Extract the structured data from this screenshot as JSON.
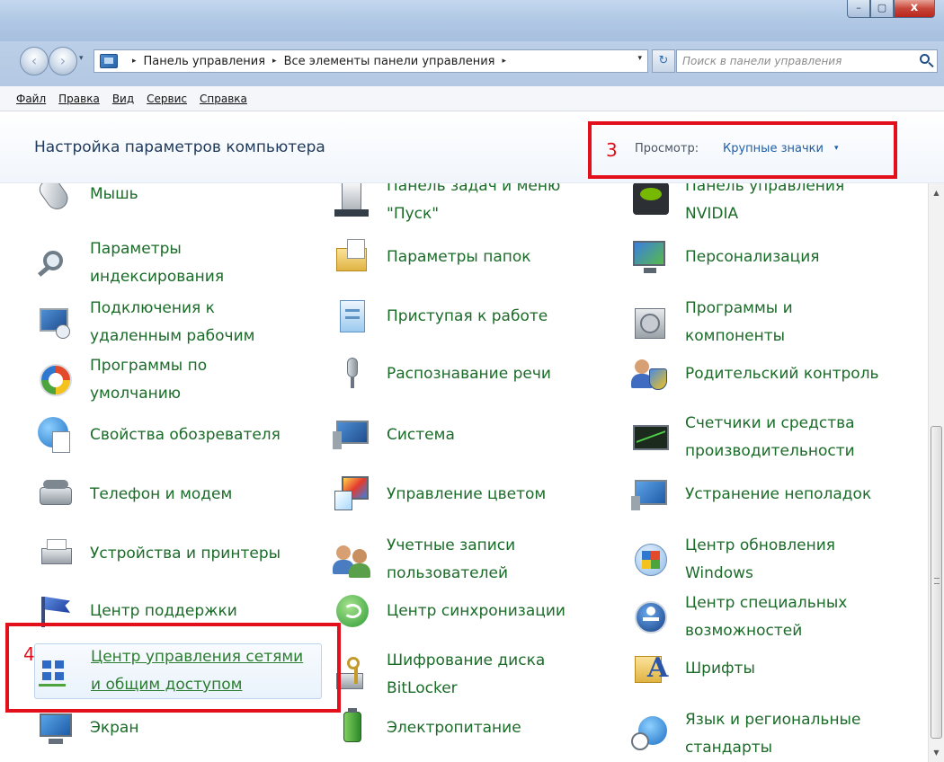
{
  "window": {
    "buttons": {
      "minimize": "–",
      "maximize": "▢",
      "close": "x"
    }
  },
  "nav": {
    "back": "‹",
    "forward": "›",
    "dropdown": "▾",
    "breadcrumb": [
      "Панель управления",
      "Все элементы панели управления"
    ],
    "separator": "▸",
    "address_dropdown": "▾",
    "refresh": "↻",
    "search_placeholder": "Поиск в панели управления"
  },
  "menu": [
    "Файл",
    "Правка",
    "Вид",
    "Сервис",
    "Справка"
  ],
  "header": {
    "title": "Настройка параметров компьютера",
    "view_label": "Просмотр:",
    "view_value": "Крупные значки",
    "view_caret": "▾"
  },
  "items": {
    "col1": [
      {
        "label": "Мышь",
        "icon": "mouse-icon"
      },
      {
        "label": "Параметры индексирования",
        "icon": "indexing-icon"
      },
      {
        "label": "Подключения к удаленным рабочим",
        "icon": "remote-desktop-icon"
      },
      {
        "label": "Программы по умолчанию",
        "icon": "default-programs-icon"
      },
      {
        "label": "Свойства обозревателя",
        "icon": "internet-options-icon"
      },
      {
        "label": "Телефон и модем",
        "icon": "phone-modem-icon"
      },
      {
        "label": "Устройства и принтеры",
        "icon": "printer-icon"
      },
      {
        "label": "Центр поддержки",
        "icon": "action-center-flag-icon"
      },
      {
        "label": "Центр управления сетями и общим доступом",
        "icon": "network-center-icon"
      },
      {
        "label": "Экран",
        "icon": "display-icon"
      }
    ],
    "col2": [
      {
        "label": "Панель задач и меню \"Пуск\"",
        "icon": "taskbar-icon"
      },
      {
        "label": "Параметры папок",
        "icon": "folder-options-icon"
      },
      {
        "label": "Приступая к работе",
        "icon": "getting-started-icon"
      },
      {
        "label": "Распознавание речи",
        "icon": "microphone-icon"
      },
      {
        "label": "Система",
        "icon": "system-icon"
      },
      {
        "label": "Управление цветом",
        "icon": "color-management-icon"
      },
      {
        "label": "Учетные записи пользователей",
        "icon": "user-accounts-icon"
      },
      {
        "label": "Центр синхронизации",
        "icon": "sync-center-icon"
      },
      {
        "label": "Шифрование диска BitLocker",
        "icon": "bitlocker-icon"
      },
      {
        "label": "Электропитание",
        "icon": "power-options-icon"
      }
    ],
    "col3": [
      {
        "label": "Панель управления NVIDIA",
        "icon": "nvidia-icon"
      },
      {
        "label": "Персонализация",
        "icon": "personalization-icon"
      },
      {
        "label": "Программы и компоненты",
        "icon": "programs-features-icon"
      },
      {
        "label": "Родительский контроль",
        "icon": "parental-controls-icon"
      },
      {
        "label": "Счетчики и средства производительности",
        "icon": "performance-icon"
      },
      {
        "label": "Устранение неполадок",
        "icon": "troubleshooting-icon"
      },
      {
        "label": "Центр обновления Windows",
        "icon": "windows-update-icon"
      },
      {
        "label": "Центр специальных возможностей",
        "icon": "ease-of-access-icon"
      },
      {
        "label": "Шрифты",
        "icon": "fonts-icon"
      },
      {
        "label": "Язык и региональные стандарты",
        "icon": "region-language-icon"
      }
    ]
  },
  "scrollbar": {
    "up": "▲",
    "down": "▼"
  },
  "annotations": {
    "callout3": "3",
    "callout4": "4"
  },
  "colors": {
    "link": "#1b6b29",
    "header": "#1e395b",
    "callout": "#e3101c",
    "view_link": "#1f5ea8"
  }
}
